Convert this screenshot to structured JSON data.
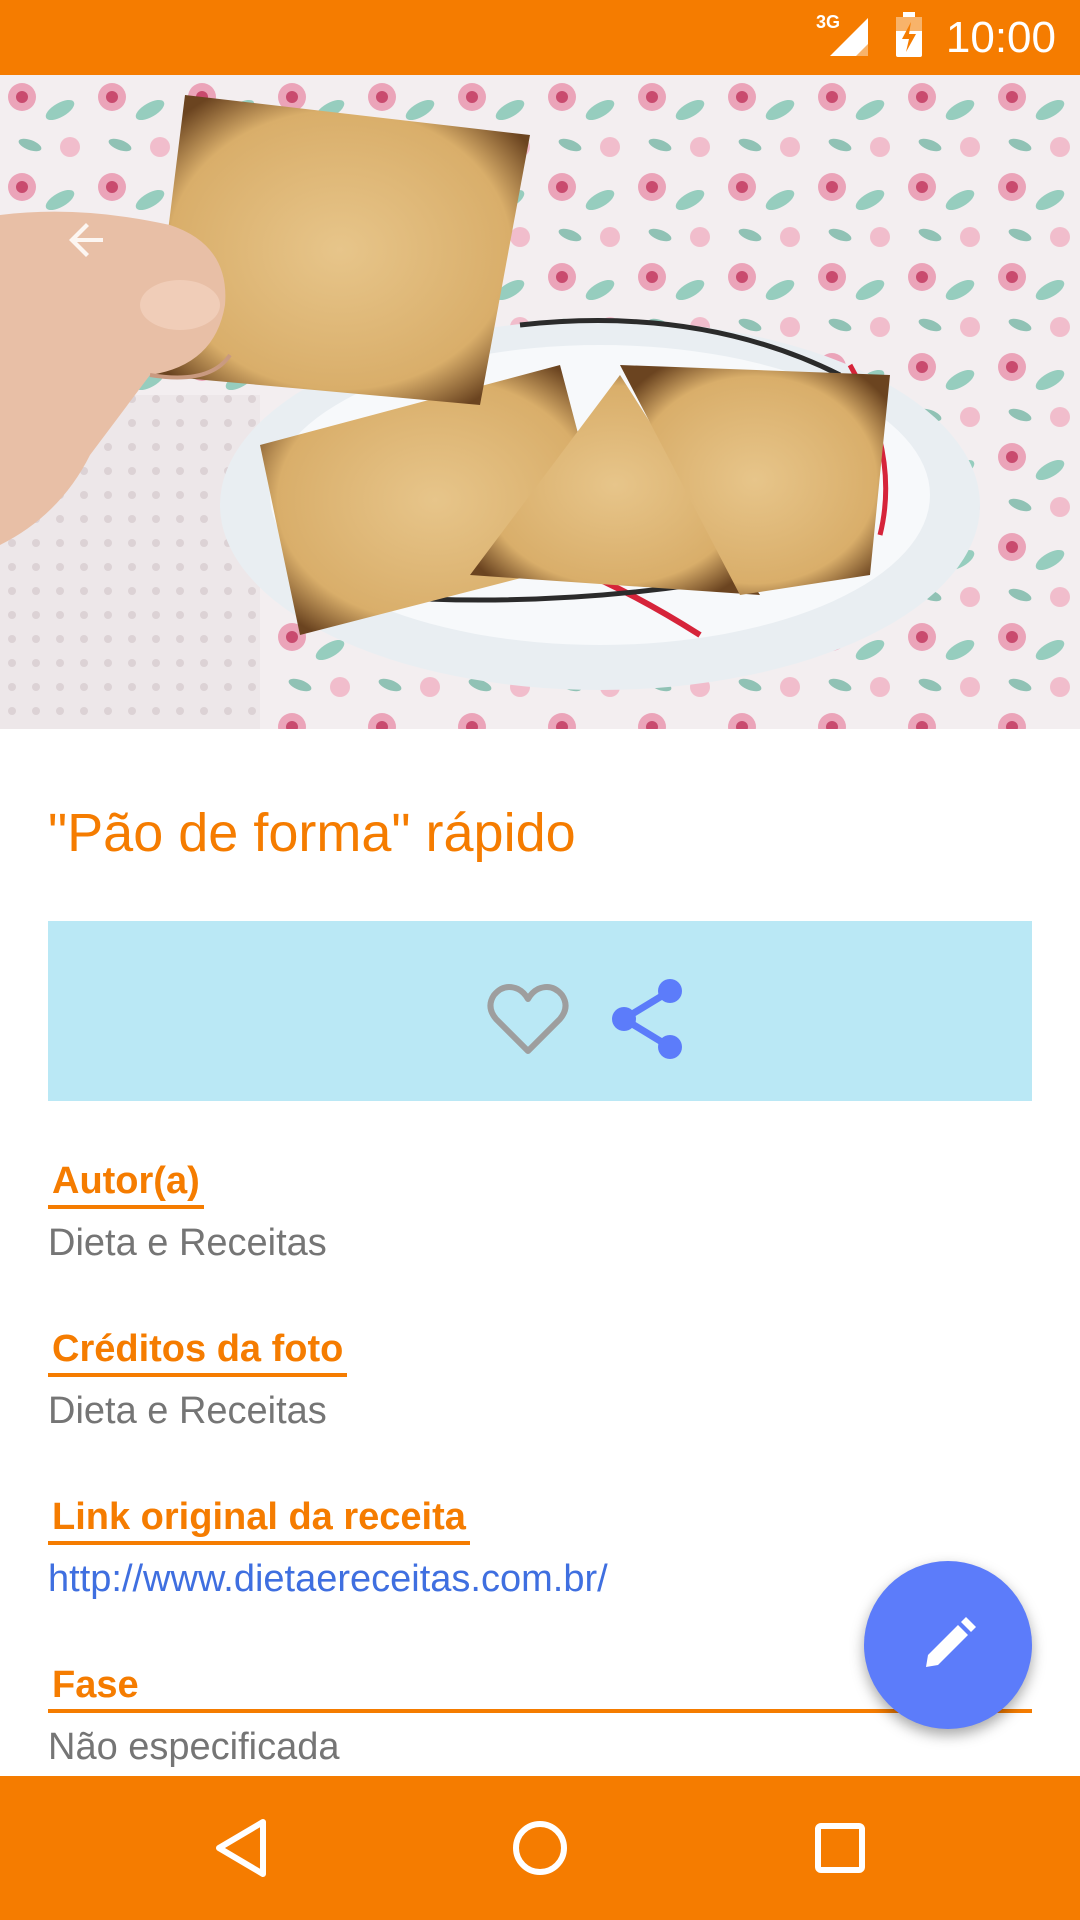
{
  "status_bar": {
    "network": "3G",
    "time": "10:00",
    "icons": [
      "signal-icon",
      "battery-charging-icon"
    ]
  },
  "recipe": {
    "title": "\"Pão de forma\" rápido",
    "image_description_icon": "bread-photo",
    "actions": {
      "favorite_icon": "heart-outline-icon",
      "share_icon": "share-icon"
    },
    "fields": {
      "author_label": "Autor(a)",
      "author_value": "Dieta e Receitas",
      "credits_label": "Créditos da foto",
      "credits_value": "Dieta e Receitas",
      "link_label": "Link original da receita",
      "link_value": "http://www.dietaereceitas.com.br/",
      "phase_label": "Fase",
      "phase_value": "Não especificada"
    }
  },
  "fab": {
    "icon": "pencil-icon"
  },
  "navigation": {
    "icons": [
      "nav-back-icon",
      "nav-home-icon",
      "nav-recents-icon"
    ]
  },
  "colors": {
    "primary": "#F57C00",
    "action_bar": "#BAE8F5",
    "fab": "#5C7CFA",
    "link": "#3F6FE0",
    "text_secondary": "#757575"
  }
}
